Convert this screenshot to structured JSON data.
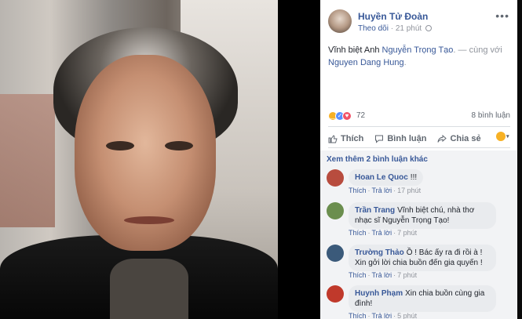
{
  "post": {
    "author": "Huyền Tử Đoàn",
    "follow": "Theo dõi",
    "dot": " · ",
    "time": "21 phút",
    "more": "•••",
    "text_prefix": "Vĩnh biệt Anh ",
    "mention1": "Nguyễn Trọng Tạo",
    "text_mid": ". — cùng với ",
    "mention2": "Nguyen Dang Hung",
    "text_end": "."
  },
  "stats": {
    "reaction_count": "72",
    "comment_count": "8 bình luận"
  },
  "actions": {
    "like": "Thích",
    "comment": "Bình luận",
    "share": "Chia sẻ"
  },
  "comments_section": {
    "view_more": "Xem thêm 2 bình luận khác",
    "items": [
      {
        "name": "Hoan Le Quoc",
        "text": "!!!",
        "like": "Thích",
        "reply": "Trả lời",
        "time": "17 phút",
        "avatar_color": "#b84c3e"
      },
      {
        "name": "Trần Trang",
        "text": "Vĩnh biệt chú, nhà thơ nhạc sĩ Nguyễn Trọng Tạo!",
        "like": "Thích",
        "reply": "Trả lời",
        "time": "7 phút",
        "avatar_color": "#6b8e4e"
      },
      {
        "name": "Trường Thảo",
        "text": "Ồ ! Bác ấy ra đi rồi à ! Xin gởi lời chia buồn đến gia quyến !",
        "like": "Thích",
        "reply": "Trả lời",
        "time": "7 phút",
        "avatar_color": "#3b5a7a"
      },
      {
        "name": "Huynh Phạm",
        "text": "Xin chia buồn cùng gia đình!",
        "like": "Thích",
        "reply": "Trả lời",
        "time": "5 phút",
        "avatar_color": "#c0392b"
      }
    ]
  },
  "colors": {
    "link": "#385898",
    "muted": "#90949c"
  }
}
